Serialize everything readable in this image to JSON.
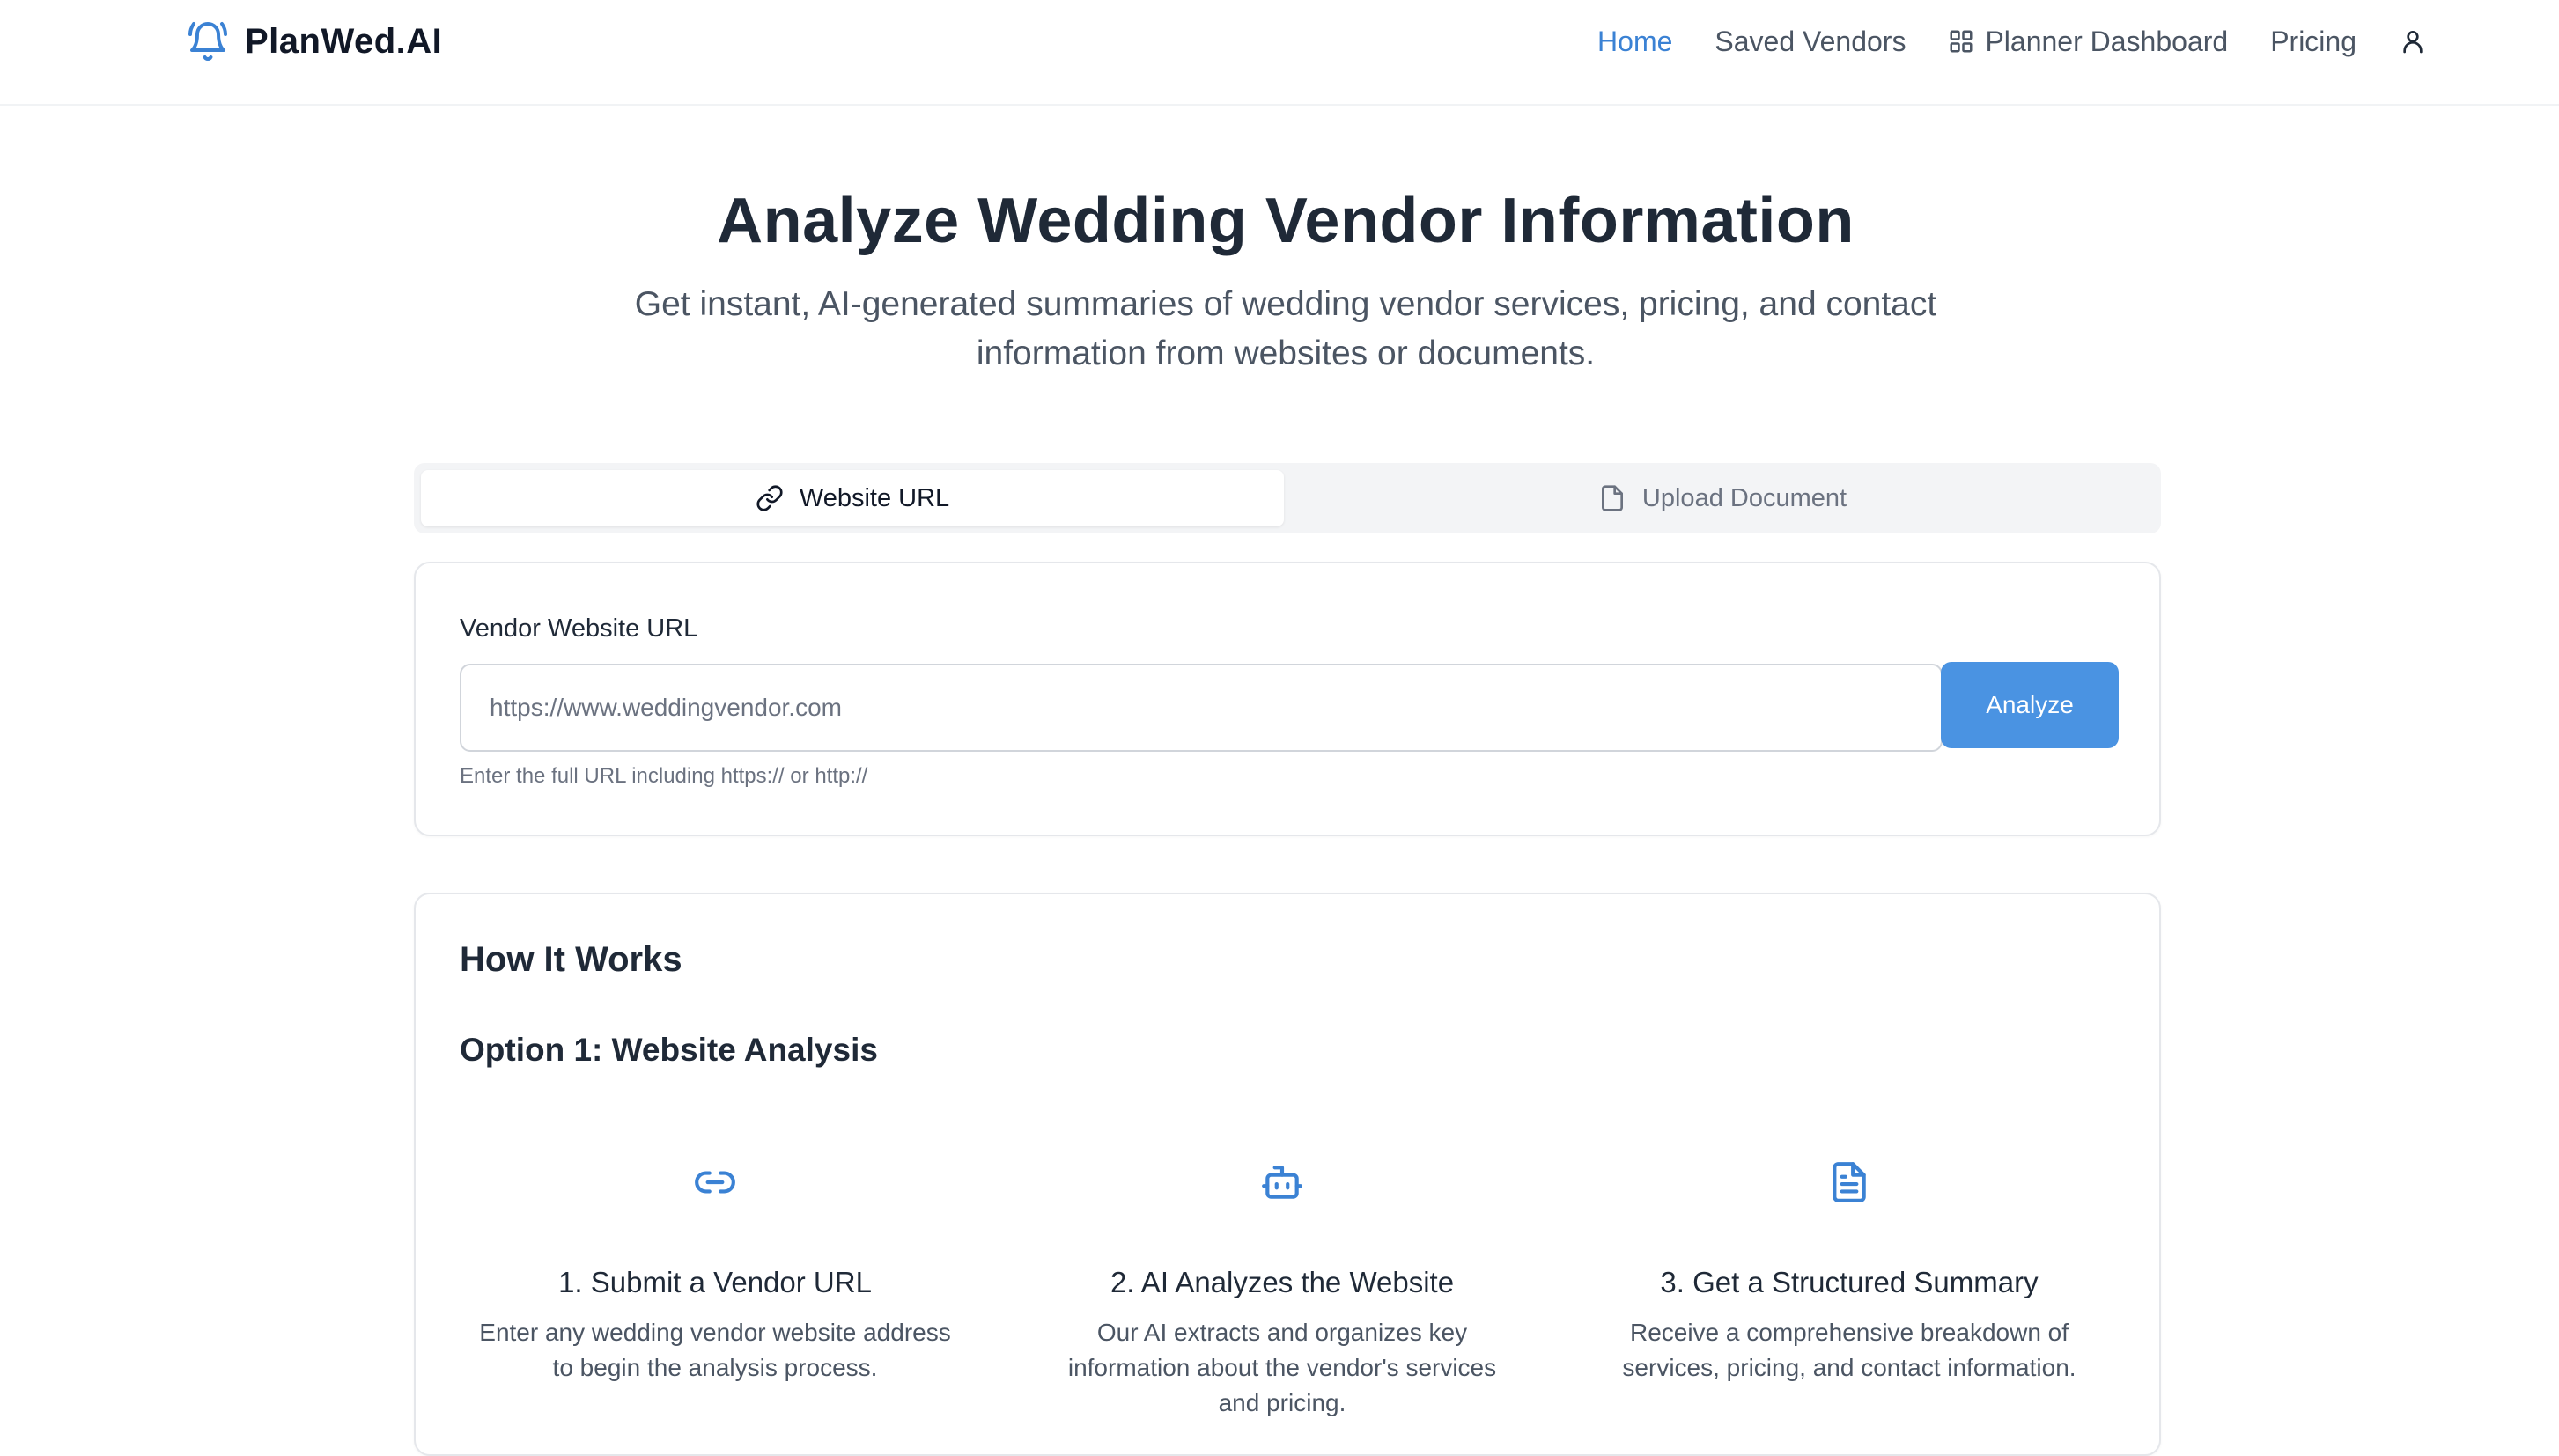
{
  "app": {
    "name": "PlanWed.AI",
    "accent": "#3b82d4"
  },
  "nav": {
    "home": "Home",
    "saved": "Saved Vendors",
    "dashboard": "Planner Dashboard",
    "pricing": "Pricing"
  },
  "hero": {
    "title": "Analyze Wedding Vendor Information",
    "subtitle": "Get instant, AI-generated summaries of wedding vendor services, pricing, and contact information from websites or documents."
  },
  "tabs": {
    "url": "Website URL",
    "upload": "Upload Document"
  },
  "url_form": {
    "label": "Vendor Website URL",
    "placeholder": "https://www.weddingvendor.com",
    "button": "Analyze",
    "hint": "Enter the full URL including https:// or http://"
  },
  "how": {
    "title": "How It Works",
    "option1": "Option 1: Website Analysis",
    "steps": [
      {
        "icon": "link-icon",
        "title": "1. Submit a Vendor URL",
        "desc": "Enter any wedding vendor website address to begin the analysis process."
      },
      {
        "icon": "bot-icon",
        "title": "2. AI Analyzes the Website",
        "desc": "Our AI extracts and organizes key information about the vendor's services and pricing."
      },
      {
        "icon": "document-icon",
        "title": "3. Get a Structured Summary",
        "desc": "Receive a comprehensive breakdown of services, pricing, and contact information."
      }
    ]
  }
}
